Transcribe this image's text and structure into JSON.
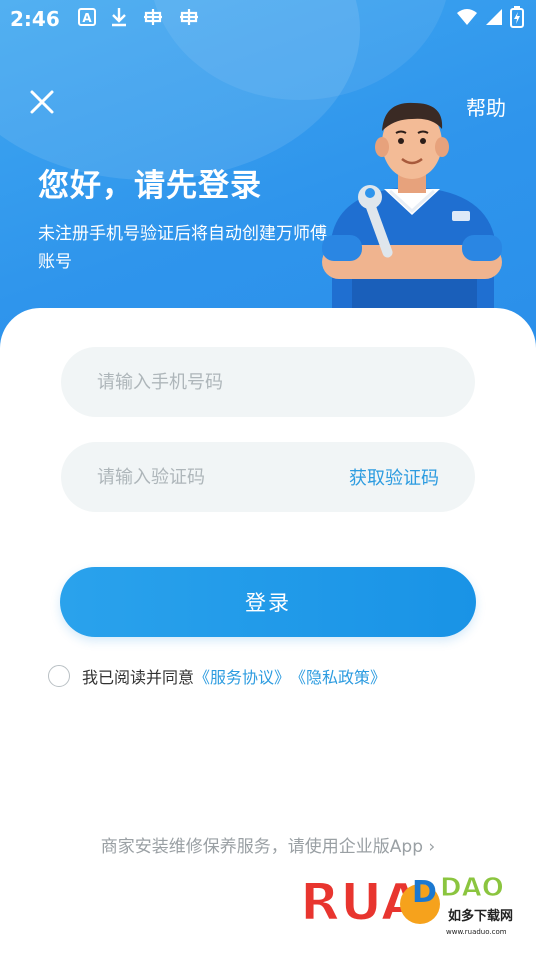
{
  "status_bar": {
    "time": "2:46",
    "icons": [
      "a-notification-icon",
      "download-icon",
      "bug-icon",
      "bug-icon",
      "wifi-icon",
      "signal-icon",
      "battery-icon"
    ]
  },
  "header": {
    "close_label": "✕",
    "help_label": "帮助",
    "greeting": "您好，请先登录",
    "subtitle": "未注册手机号验证后将自动创建万师傅账号"
  },
  "form": {
    "phone_placeholder": "请输入手机号码",
    "code_placeholder": "请输入验证码",
    "get_code_label": "获取验证码",
    "login_label": "登录"
  },
  "agreement": {
    "prefix": "我已阅读并同意",
    "service_link": "《服务协议》",
    "privacy_link": "《隐私政策》"
  },
  "footer": {
    "note": "商家安装维修保养服务，请使用企业版App ›"
  },
  "watermark": {
    "brand": "RUAODAO",
    "site_cn": "如多下载网",
    "site_url": "www.ruaduo.com"
  },
  "colors": {
    "primary": "#2a9eea",
    "link": "#2d9ce0",
    "field_bg": "#f1f5f6"
  }
}
